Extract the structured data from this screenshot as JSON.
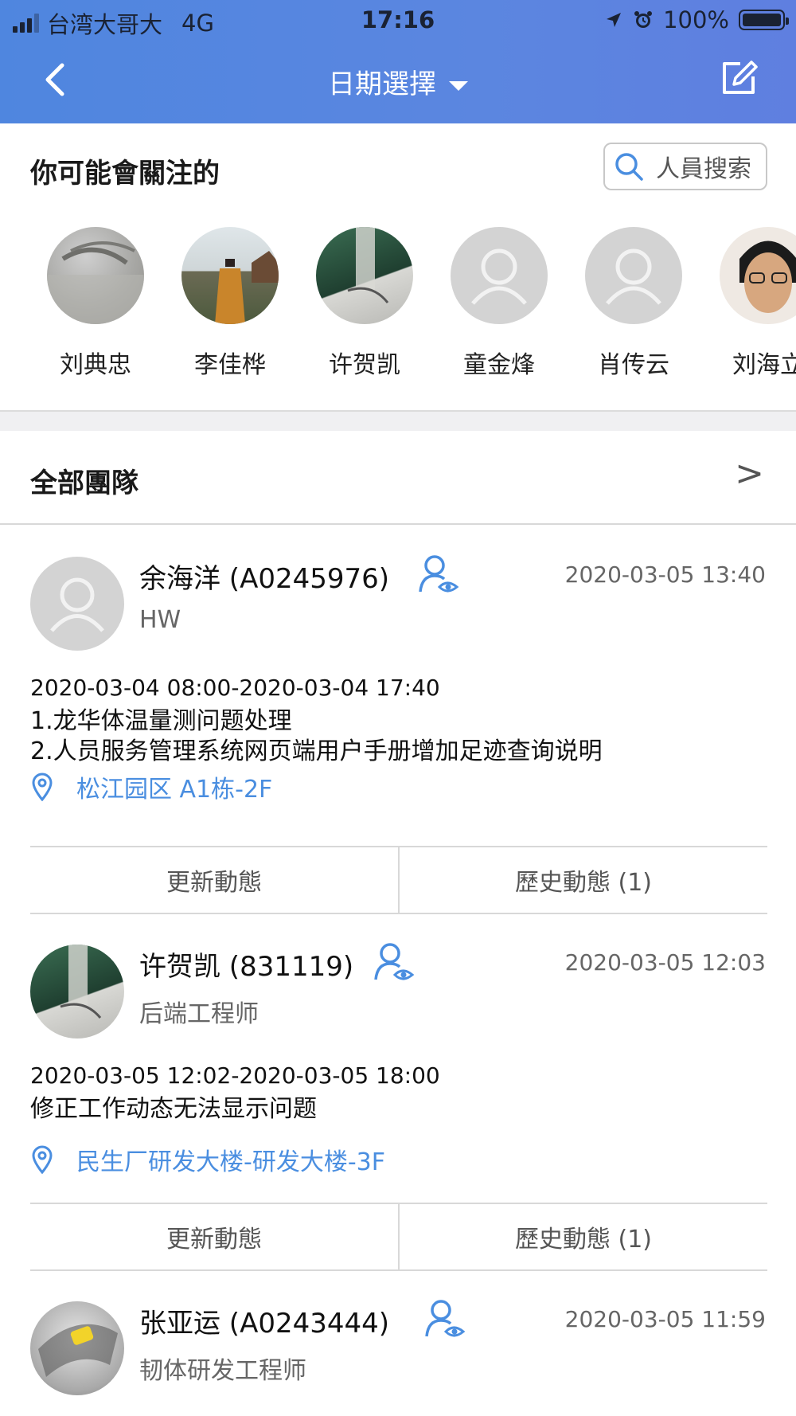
{
  "status_bar": {
    "carrier": "台湾大哥大",
    "network": "4G",
    "time": "17:16",
    "battery": "100%"
  },
  "nav": {
    "title": "日期選擇"
  },
  "recommend": {
    "title": "你可能會關注的",
    "search_placeholder": "人員搜索",
    "people": [
      {
        "name": "刘典忠",
        "avatar": "photo"
      },
      {
        "name": "李佳桦",
        "avatar": "photo"
      },
      {
        "name": "许贺凯",
        "avatar": "photo"
      },
      {
        "name": "童金烽",
        "avatar": "default"
      },
      {
        "name": "肖传云",
        "avatar": "default"
      },
      {
        "name": "刘海立",
        "avatar": "photo"
      }
    ]
  },
  "team": {
    "label": "全部團隊",
    "arrow": ">"
  },
  "feed": [
    {
      "name": "余海洋 (A0245976)",
      "role": "HW",
      "time": "2020-03-05 13:40",
      "period": "2020-03-04 08:00-2020-03-04 17:40",
      "tasks": [
        "1.龙华体温量测问题处理",
        "2.人员服务管理系统网页端用户手册增加足迹查询说明"
      ],
      "location": "松江园区 A1栋-2F",
      "update_label": "更新動態",
      "history_label": "歷史動態 (1)"
    },
    {
      "name": "许贺凯 (831119)",
      "role": "后端工程师",
      "time": "2020-03-05 12:03",
      "period": "2020-03-05 12:02-2020-03-05 18:00",
      "tasks": [
        "修正工作动态无法显示问题"
      ],
      "location": "民生厂研发大楼-研发大楼-3F",
      "update_label": "更新動態",
      "history_label": "歷史動態 (1)"
    },
    {
      "name": "张亚运 (A0243444)",
      "role": "韧体研发工程师",
      "time": "2020-03-05 11:59"
    }
  ],
  "colors": {
    "header_start": "#4f86df",
    "header_end": "#5f7fe0",
    "accent_blue": "#4a8ee0"
  }
}
